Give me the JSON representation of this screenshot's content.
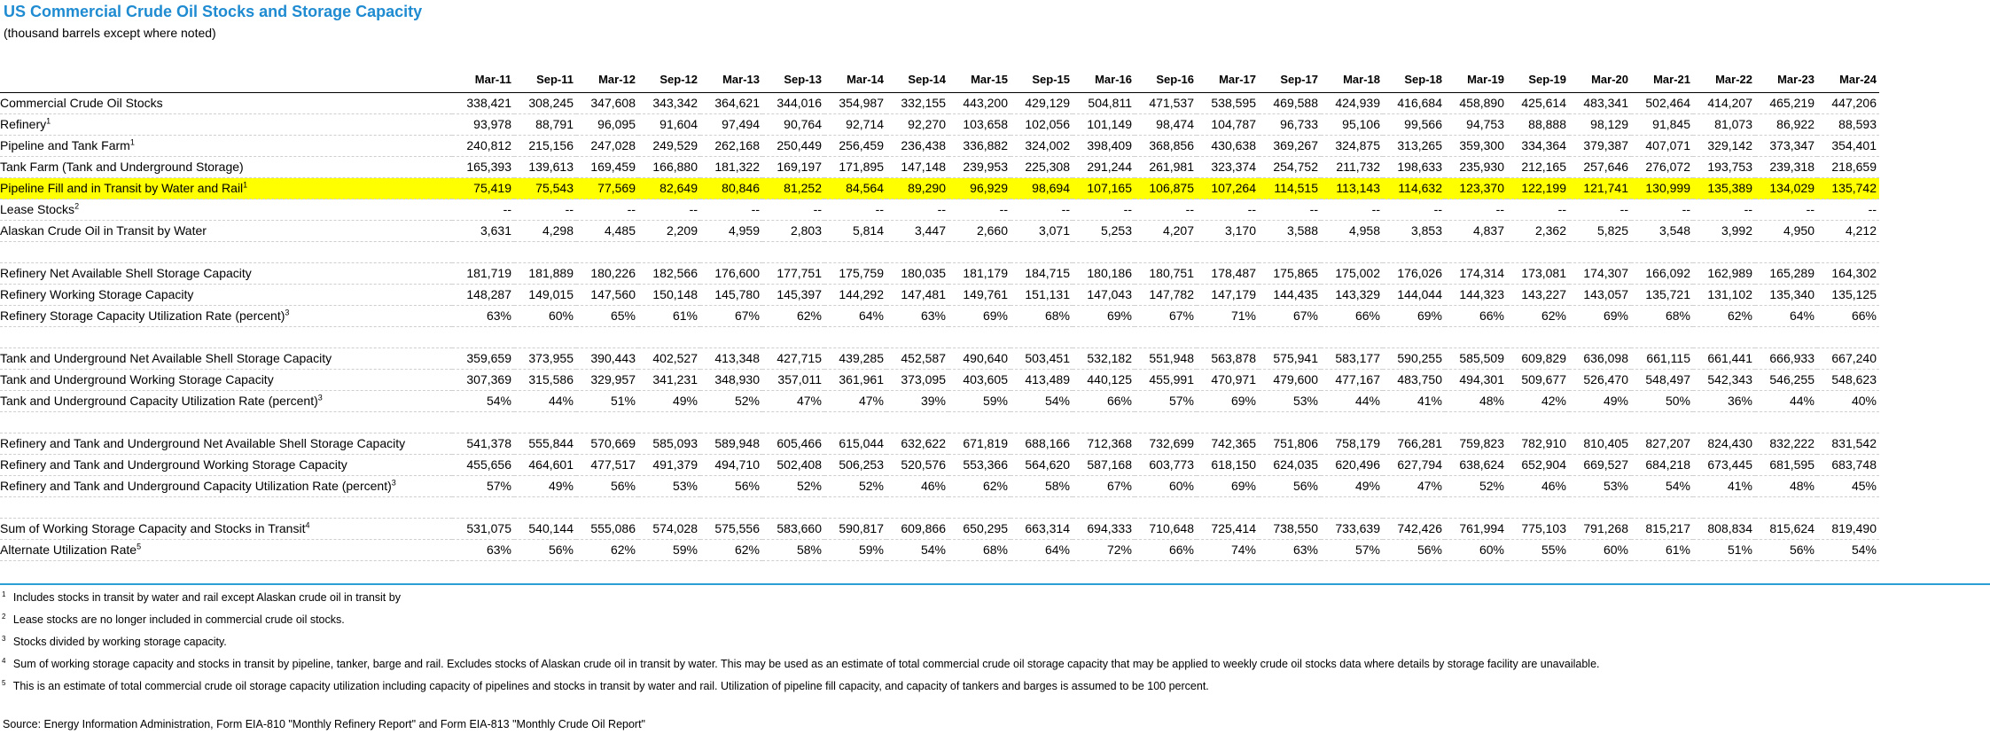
{
  "title": "US Commercial Crude Oil Stocks and Storage Capacity",
  "subtitle": "(thousand barrels except where noted)",
  "columns": [
    "Mar-11",
    "Sep-11",
    "Mar-12",
    "Sep-12",
    "Mar-13",
    "Sep-13",
    "Mar-14",
    "Sep-14",
    "Mar-15",
    "Sep-15",
    "Mar-16",
    "Sep-16",
    "Mar-17",
    "Sep-17",
    "Mar-18",
    "Sep-18",
    "Mar-19",
    "Sep-19",
    "Mar-20",
    "Mar-21",
    "Mar-22",
    "Mar-23",
    "Mar-24"
  ],
  "rows": [
    {
      "label": "Commercial Crude Oil Stocks",
      "sup": "",
      "indent": 0,
      "highlight": false,
      "values": [
        "338,421",
        "308,245",
        "347,608",
        "343,342",
        "364,621",
        "344,016",
        "354,987",
        "332,155",
        "443,200",
        "429,129",
        "504,811",
        "471,537",
        "538,595",
        "469,588",
        "424,939",
        "416,684",
        "458,890",
        "425,614",
        "483,341",
        "502,464",
        "414,207",
        "465,219",
        "447,206"
      ]
    },
    {
      "label": "Refinery",
      "sup": "1",
      "indent": 1,
      "highlight": false,
      "values": [
        "93,978",
        "88,791",
        "96,095",
        "91,604",
        "97,494",
        "90,764",
        "92,714",
        "92,270",
        "103,658",
        "102,056",
        "101,149",
        "98,474",
        "104,787",
        "96,733",
        "95,106",
        "99,566",
        "94,753",
        "88,888",
        "98,129",
        "91,845",
        "81,073",
        "86,922",
        "88,593"
      ]
    },
    {
      "label": "Pipeline and Tank Farm",
      "sup": "1",
      "indent": 1,
      "highlight": false,
      "values": [
        "240,812",
        "215,156",
        "247,028",
        "249,529",
        "262,168",
        "250,449",
        "256,459",
        "236,438",
        "336,882",
        "324,002",
        "398,409",
        "368,856",
        "430,638",
        "369,267",
        "324,875",
        "313,265",
        "359,300",
        "334,364",
        "379,387",
        "407,071",
        "329,142",
        "373,347",
        "354,401"
      ]
    },
    {
      "label": "Tank Farm (Tank and Underground Storage)",
      "sup": "",
      "indent": 2,
      "highlight": false,
      "values": [
        "165,393",
        "139,613",
        "169,459",
        "166,880",
        "181,322",
        "169,197",
        "171,895",
        "147,148",
        "239,953",
        "225,308",
        "291,244",
        "261,981",
        "323,374",
        "254,752",
        "211,732",
        "198,633",
        "235,930",
        "212,165",
        "257,646",
        "276,072",
        "193,753",
        "239,318",
        "218,659"
      ]
    },
    {
      "label": "Pipeline Fill and in Transit by Water and Rail",
      "sup": "1",
      "indent": 2,
      "highlight": true,
      "values": [
        "75,419",
        "75,543",
        "77,569",
        "82,649",
        "80,846",
        "81,252",
        "84,564",
        "89,290",
        "96,929",
        "98,694",
        "107,165",
        "106,875",
        "107,264",
        "114,515",
        "113,143",
        "114,632",
        "123,370",
        "122,199",
        "121,741",
        "130,999",
        "135,389",
        "134,029",
        "135,742"
      ]
    },
    {
      "label": "Lease Stocks",
      "sup": "2",
      "indent": 1,
      "highlight": false,
      "values": [
        "--",
        "--",
        "--",
        "--",
        "--",
        "--",
        "--",
        "--",
        "--",
        "--",
        "--",
        "--",
        "--",
        "--",
        "--",
        "--",
        "--",
        "--",
        "--",
        "--",
        "--",
        "--",
        "--"
      ]
    },
    {
      "label": "Alaskan Crude Oil in Transit by Water",
      "sup": "",
      "indent": 1,
      "highlight": false,
      "values": [
        "3,631",
        "4,298",
        "4,485",
        "2,209",
        "4,959",
        "2,803",
        "5,814",
        "3,447",
        "2,660",
        "3,071",
        "5,253",
        "4,207",
        "3,170",
        "3,588",
        "4,958",
        "3,853",
        "4,837",
        "2,362",
        "5,825",
        "3,548",
        "3,992",
        "4,950",
        "4,212"
      ]
    },
    {
      "spacer": true
    },
    {
      "label": "Refinery Net Available Shell Storage Capacity",
      "sup": "",
      "indent": 0,
      "highlight": false,
      "values": [
        "181,719",
        "181,889",
        "180,226",
        "182,566",
        "176,600",
        "177,751",
        "175,759",
        "180,035",
        "181,179",
        "184,715",
        "180,186",
        "180,751",
        "178,487",
        "175,865",
        "175,002",
        "176,026",
        "174,314",
        "173,081",
        "174,307",
        "166,092",
        "162,989",
        "165,289",
        "164,302"
      ]
    },
    {
      "label": "Refinery Working Storage Capacity",
      "sup": "",
      "indent": 0,
      "highlight": false,
      "values": [
        "148,287",
        "149,015",
        "147,560",
        "150,148",
        "145,780",
        "145,397",
        "144,292",
        "147,481",
        "149,761",
        "151,131",
        "147,043",
        "147,782",
        "147,179",
        "144,435",
        "143,329",
        "144,044",
        "144,323",
        "143,227",
        "143,057",
        "135,721",
        "131,102",
        "135,340",
        "135,125"
      ]
    },
    {
      "label": "Refinery Storage Capacity Utilization Rate (percent)",
      "sup": "3",
      "indent": 0,
      "highlight": false,
      "values": [
        "63%",
        "60%",
        "65%",
        "61%",
        "67%",
        "62%",
        "64%",
        "63%",
        "69%",
        "68%",
        "69%",
        "67%",
        "71%",
        "67%",
        "66%",
        "69%",
        "66%",
        "62%",
        "69%",
        "68%",
        "62%",
        "64%",
        "66%"
      ]
    },
    {
      "spacer": true
    },
    {
      "label": "Tank and Underground Net Available Shell Storage Capacity",
      "sup": "",
      "indent": 0,
      "highlight": false,
      "values": [
        "359,659",
        "373,955",
        "390,443",
        "402,527",
        "413,348",
        "427,715",
        "439,285",
        "452,587",
        "490,640",
        "503,451",
        "532,182",
        "551,948",
        "563,878",
        "575,941",
        "583,177",
        "590,255",
        "585,509",
        "609,829",
        "636,098",
        "661,115",
        "661,441",
        "666,933",
        "667,240"
      ]
    },
    {
      "label": "Tank and Underground Working Storage Capacity",
      "sup": "",
      "indent": 0,
      "highlight": false,
      "values": [
        "307,369",
        "315,586",
        "329,957",
        "341,231",
        "348,930",
        "357,011",
        "361,961",
        "373,095",
        "403,605",
        "413,489",
        "440,125",
        "455,991",
        "470,971",
        "479,600",
        "477,167",
        "483,750",
        "494,301",
        "509,677",
        "526,470",
        "548,497",
        "542,343",
        "546,255",
        "548,623"
      ]
    },
    {
      "label": "Tank and Underground Capacity Utilization Rate (percent)",
      "sup": "3",
      "indent": 0,
      "highlight": false,
      "values": [
        "54%",
        "44%",
        "51%",
        "49%",
        "52%",
        "47%",
        "47%",
        "39%",
        "59%",
        "54%",
        "66%",
        "57%",
        "69%",
        "53%",
        "44%",
        "41%",
        "48%",
        "42%",
        "49%",
        "50%",
        "36%",
        "44%",
        "40%"
      ]
    },
    {
      "spacer": true
    },
    {
      "label": "Refinery and Tank and Underground Net Available Shell Storage Capacity",
      "sup": "",
      "indent": 0,
      "highlight": false,
      "values": [
        "541,378",
        "555,844",
        "570,669",
        "585,093",
        "589,948",
        "605,466",
        "615,044",
        "632,622",
        "671,819",
        "688,166",
        "712,368",
        "732,699",
        "742,365",
        "751,806",
        "758,179",
        "766,281",
        "759,823",
        "782,910",
        "810,405",
        "827,207",
        "824,430",
        "832,222",
        "831,542"
      ]
    },
    {
      "label": "Refinery and Tank and Underground Working Storage Capacity",
      "sup": "",
      "indent": 0,
      "highlight": false,
      "values": [
        "455,656",
        "464,601",
        "477,517",
        "491,379",
        "494,710",
        "502,408",
        "506,253",
        "520,576",
        "553,366",
        "564,620",
        "587,168",
        "603,773",
        "618,150",
        "624,035",
        "620,496",
        "627,794",
        "638,624",
        "652,904",
        "669,527",
        "684,218",
        "673,445",
        "681,595",
        "683,748"
      ]
    },
    {
      "label": "Refinery and Tank and Underground Capacity Utilization Rate (percent)",
      "sup": "3",
      "indent": 0,
      "highlight": false,
      "values": [
        "57%",
        "49%",
        "56%",
        "53%",
        "56%",
        "52%",
        "52%",
        "46%",
        "62%",
        "58%",
        "67%",
        "60%",
        "69%",
        "56%",
        "49%",
        "47%",
        "52%",
        "46%",
        "53%",
        "54%",
        "41%",
        "48%",
        "45%"
      ]
    },
    {
      "spacer": true
    },
    {
      "label": "Sum of Working Storage Capacity and Stocks in Transit",
      "sup": "4",
      "indent": 0,
      "highlight": false,
      "values": [
        "531,075",
        "540,144",
        "555,086",
        "574,028",
        "575,556",
        "583,660",
        "590,817",
        "609,866",
        "650,295",
        "663,314",
        "694,333",
        "710,648",
        "725,414",
        "738,550",
        "733,639",
        "742,426",
        "761,994",
        "775,103",
        "791,268",
        "815,217",
        "808,834",
        "815,624",
        "819,490"
      ]
    },
    {
      "label": "Alternate Utilization Rate",
      "sup": "5",
      "indent": 0,
      "highlight": false,
      "values": [
        "63%",
        "56%",
        "62%",
        "59%",
        "62%",
        "58%",
        "59%",
        "54%",
        "68%",
        "64%",
        "72%",
        "66%",
        "74%",
        "63%",
        "57%",
        "56%",
        "60%",
        "55%",
        "60%",
        "61%",
        "51%",
        "56%",
        "54%"
      ]
    }
  ],
  "footnotes": [
    {
      "sup": "1",
      "text": "Includes stocks in transit by water and rail except Alaskan crude oil in transit by"
    },
    {
      "sup": "2",
      "text": "Lease stocks are no longer included in commercial crude oil stocks."
    },
    {
      "sup": "3",
      "text": "Stocks divided by working storage capacity."
    },
    {
      "sup": "4",
      "text": "Sum of working storage capacity and stocks in transit by pipeline, tanker, barge and rail.  Excludes stocks of Alaskan crude oil in transit by water.  This may be used as an estimate of total commercial crude oil storage capacity that may be applied to weekly crude oil stocks data where details by storage facility are unavailable."
    },
    {
      "sup": "5",
      "text": "This is an estimate of total commercial crude oil storage capacity utilization including capacity of pipelines and stocks in transit by water and rail.  Utilization of pipeline fill capacity, and capacity of tankers and barges is assumed to be 100 percent."
    }
  ],
  "source": "Source:  Energy Information Administration, Form EIA-810 \"Monthly Refinery Report\" and Form EIA-813 \"Monthly Crude Oil Report\"",
  "colors": {
    "title": "#1f8bd1",
    "highlight": "#ffff00",
    "rule": "#2a9fd6"
  }
}
